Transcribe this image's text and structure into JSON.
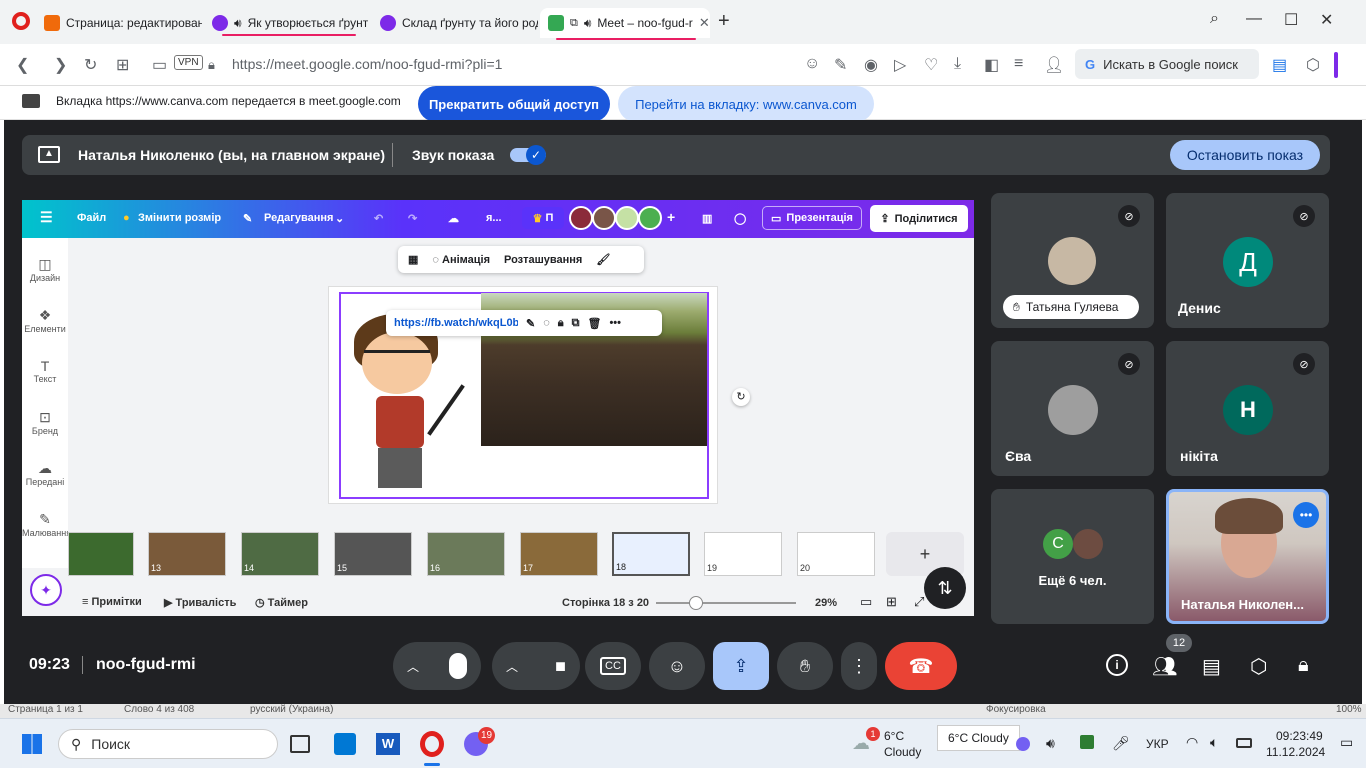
{
  "browser": {
    "tabs": [
      {
        "label": "Страница: редактирован",
        "color": "#f06a0b"
      },
      {
        "label": "Як утворюється ґрунт",
        "color": "#7d2ae8"
      },
      {
        "label": "Склад ґрунту та його род",
        "color": "#7d2ae8"
      },
      {
        "label": "Meet – noo-fgud-r",
        "color": "#34a853"
      }
    ],
    "new_tab": "+",
    "url": "https://meet.google.com/noo-fgud-rmi?pli=1",
    "vpn": "VPN",
    "search_label": "Искать в Google поиск"
  },
  "share_bar": {
    "message": "Вкладка https://www.canva.com передается в meet.google.com",
    "stop_label": "Прекратить общий доступ",
    "goto_label": "Перейти на вкладку: www.canva.com"
  },
  "presenting": {
    "name": "Наталья Николенко (вы, на главном экране)",
    "sound_label": "Звук показа",
    "stop_label": "Остановить показ"
  },
  "canva": {
    "menu": {
      "file": "Файл",
      "resize": "Змінити розмір",
      "edit": "Редагування",
      "ya": "я...",
      "pro": "П"
    },
    "present": "Презентація",
    "share": "Поділитися",
    "sidebar": [
      "Дизайн",
      "Елементи",
      "Текст",
      "Бренд",
      "Передані",
      "Малювання"
    ],
    "float_toolbar": {
      "animation": "Анімація",
      "position": "Розташування"
    },
    "link": "https://fb.watch/wkqL0bI",
    "thumbs": [
      "13",
      "14",
      "15",
      "16",
      "17",
      "18",
      "19",
      "20"
    ],
    "bottom": {
      "notes": "Примітки",
      "duration": "Тривалість",
      "timer": "Таймер",
      "page": "Сторінка 18 з 20",
      "zoom": "29%"
    }
  },
  "participants": [
    {
      "name": "Татьяна Гуляева",
      "avatar_color": "#8d7b68"
    },
    {
      "name": "Денис",
      "initial": "Д",
      "avatar_color": "#00897b"
    },
    {
      "name": "Єва",
      "avatar_color": "#9e9e9e"
    },
    {
      "name": "нікіта",
      "initial": "Н",
      "avatar_color": "#00695c"
    },
    {
      "name": "Ещё 6 чел.",
      "initial": "С",
      "avatar_color": "#43a047"
    },
    {
      "name": "Наталья Николен..."
    }
  ],
  "meeting": {
    "time": "09:23",
    "code": "noo-fgud-rmi",
    "people_count": "12"
  },
  "taskbar": {
    "search": "Поиск",
    "old_row": [
      "Страница 1 из 1",
      "Слово 4 из 408",
      "русский (Украина)",
      "Фокусировка",
      "100%"
    ],
    "weather_temp": "6°C",
    "weather_desc": "Cloudy",
    "weather_tooltip": "6°C Cloudy",
    "lang": "УКР",
    "time": "09:23:49",
    "date": "11.12.2024",
    "viber_badge": "19",
    "weather_badge": "1"
  }
}
